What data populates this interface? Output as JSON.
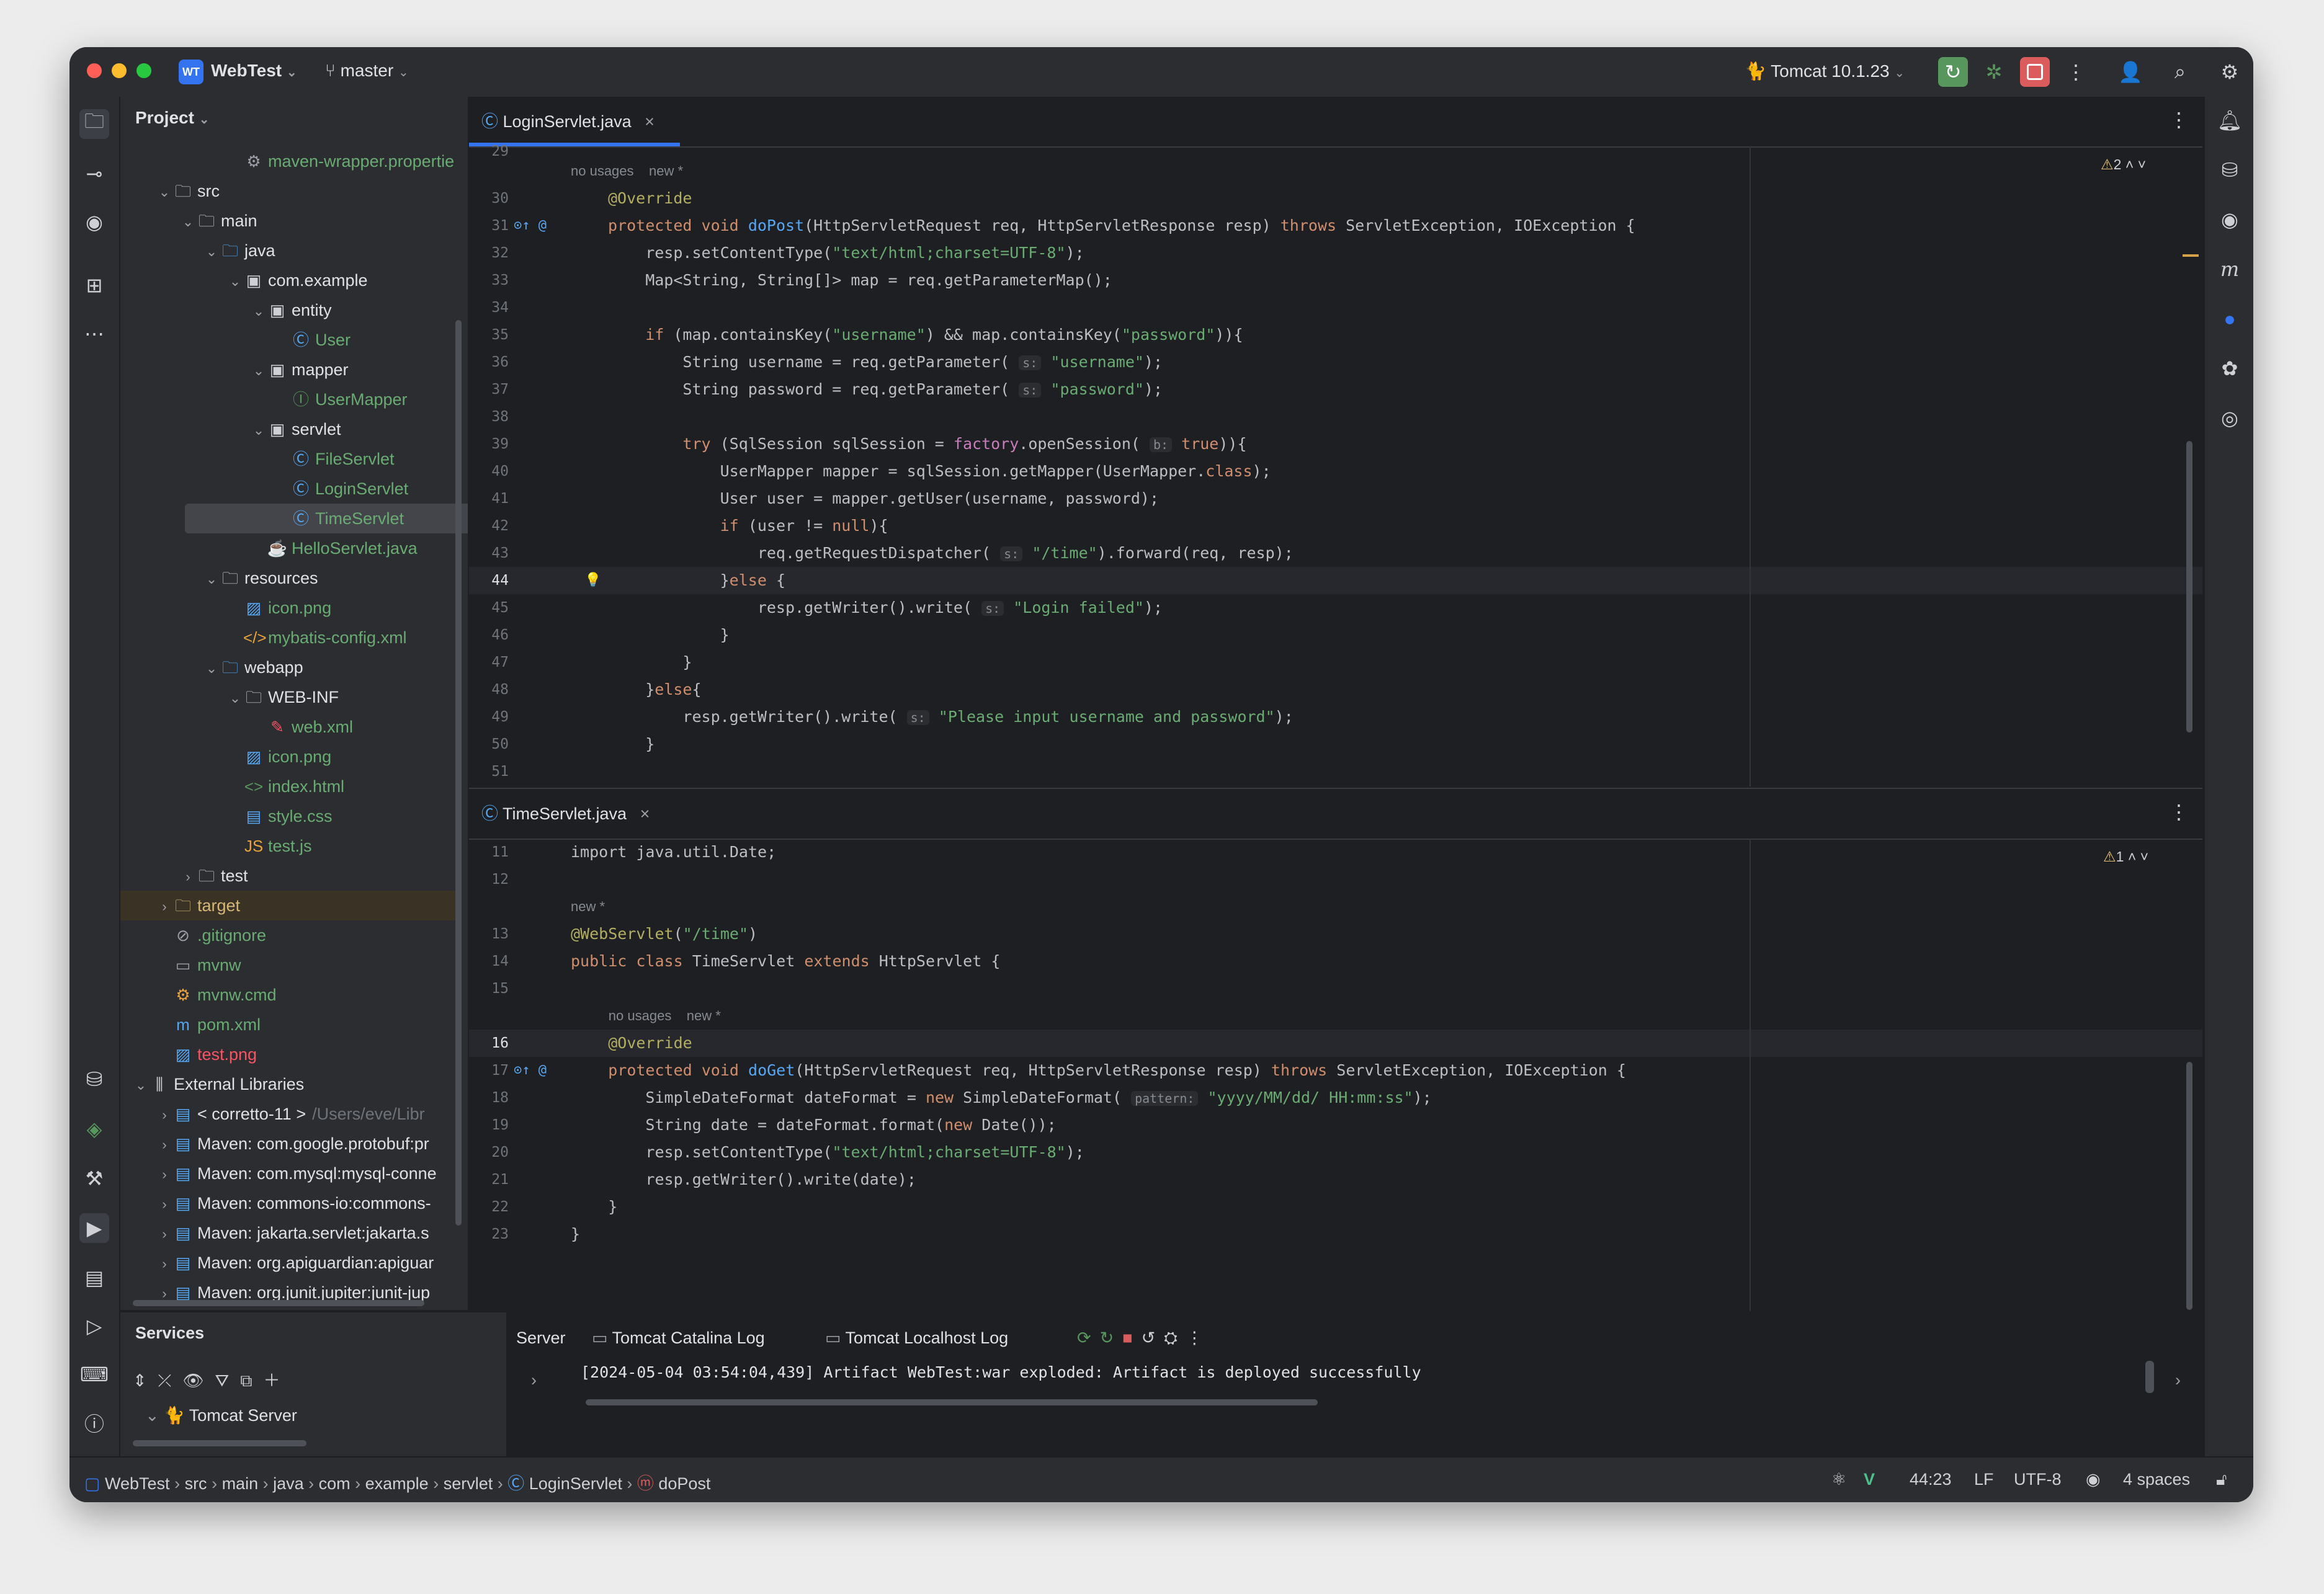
{
  "window": {
    "project_badge": "WT",
    "project_name": "WebTest",
    "branch": "master",
    "run_config": "Tomcat 10.1.23"
  },
  "project_panel": {
    "title": "Project",
    "items": [
      {
        "label": "maven-wrapper.propertie",
        "color": "#6aab73"
      },
      {
        "label": "src",
        "color": "#dfe1e5"
      },
      {
        "label": "main",
        "color": "#dfe1e5"
      },
      {
        "label": "java",
        "color": "#dfe1e5"
      },
      {
        "label": "com.example",
        "color": "#dfe1e5"
      },
      {
        "label": "entity",
        "color": "#dfe1e5"
      },
      {
        "label": "User",
        "color": "#6aab73"
      },
      {
        "label": "mapper",
        "color": "#dfe1e5"
      },
      {
        "label": "UserMapper",
        "color": "#6aab73"
      },
      {
        "label": "servlet",
        "color": "#dfe1e5"
      },
      {
        "label": "FileServlet",
        "color": "#6aab73"
      },
      {
        "label": "LoginServlet",
        "color": "#6aab73"
      },
      {
        "label": "TimeServlet",
        "color": "#6aab73"
      },
      {
        "label": "HelloServlet.java",
        "color": "#6aab73"
      },
      {
        "label": "resources",
        "color": "#dfe1e5"
      },
      {
        "label": "icon.png",
        "color": "#6aab73"
      },
      {
        "label": "mybatis-config.xml",
        "color": "#6aab73"
      },
      {
        "label": "webapp",
        "color": "#dfe1e5"
      },
      {
        "label": "WEB-INF",
        "color": "#dfe1e5"
      },
      {
        "label": "web.xml",
        "color": "#6aab73"
      },
      {
        "label": "icon.png",
        "color": "#6aab73"
      },
      {
        "label": "index.html",
        "color": "#6aab73"
      },
      {
        "label": "style.css",
        "color": "#6aab73"
      },
      {
        "label": "test.js",
        "color": "#6aab73"
      },
      {
        "label": "test",
        "color": "#dfe1e5"
      },
      {
        "label": "target",
        "color": "#d5b778"
      },
      {
        "label": ".gitignore",
        "color": "#6aab73"
      },
      {
        "label": "mvnw",
        "color": "#6aab73"
      },
      {
        "label": "mvnw.cmd",
        "color": "#6aab73"
      },
      {
        "label": "pom.xml",
        "color": "#6aab73"
      },
      {
        "label": "test.png",
        "color": "#f75464"
      },
      {
        "label": "External Libraries",
        "color": "#dfe1e5"
      },
      {
        "label": "< corretto-11 >",
        "color": "#dfe1e5",
        "suffix": "/Users/eve/Libr"
      },
      {
        "label": "Maven: com.google.protobuf:pr",
        "color": "#dfe1e5"
      },
      {
        "label": "Maven: com.mysql:mysql-conne",
        "color": "#dfe1e5"
      },
      {
        "label": "Maven: commons-io:commons-",
        "color": "#dfe1e5"
      },
      {
        "label": "Maven: jakarta.servlet:jakarta.s",
        "color": "#dfe1e5"
      },
      {
        "label": "Maven: org.apiguardian:apiguar",
        "color": "#dfe1e5"
      },
      {
        "label": "Maven: org.junit.jupiter:junit-jup",
        "color": "#dfe1e5"
      }
    ]
  },
  "editor_top": {
    "tab": "LoginServlet.java",
    "warnings": "2",
    "first_line": "29",
    "meta_usages": "no usages",
    "meta_new": "new *",
    "lines": [
      {
        "n": "30",
        "code": "@Override"
      },
      {
        "n": "31",
        "code": "protected void doPost(HttpServletRequest req, HttpServletResponse resp) throws ServletException, IOException {"
      },
      {
        "n": "32",
        "code": "    resp.setContentType(\"text/html;charset=UTF-8\");"
      },
      {
        "n": "33",
        "code": "    Map<String, String[]> map = req.getParameterMap();"
      },
      {
        "n": "34",
        "code": ""
      },
      {
        "n": "35",
        "code": "    if (map.containsKey(\"username\") && map.containsKey(\"password\")){"
      },
      {
        "n": "36",
        "code": "        String username = req.getParameter( s: \"username\");"
      },
      {
        "n": "37",
        "code": "        String password = req.getParameter( s: \"password\");"
      },
      {
        "n": "38",
        "code": ""
      },
      {
        "n": "39",
        "code": "        try (SqlSession sqlSession = factory.openSession( b: true)){"
      },
      {
        "n": "40",
        "code": "            UserMapper mapper = sqlSession.getMapper(UserMapper.class);"
      },
      {
        "n": "41",
        "code": "            User user = mapper.getUser(username, password);"
      },
      {
        "n": "42",
        "code": "            if (user != null){"
      },
      {
        "n": "43",
        "code": "                req.getRequestDispatcher( s: \"/time\").forward(req, resp);"
      },
      {
        "n": "44",
        "code": "            }else {"
      },
      {
        "n": "45",
        "code": "                resp.getWriter().write( s: \"Login failed\");"
      },
      {
        "n": "46",
        "code": "            }"
      },
      {
        "n": "47",
        "code": "        }"
      },
      {
        "n": "48",
        "code": "    }else{"
      },
      {
        "n": "49",
        "code": "        resp.getWriter().write( s: \"Please input username and password\");"
      },
      {
        "n": "50",
        "code": "    }"
      },
      {
        "n": "51",
        "code": ""
      }
    ]
  },
  "editor_bottom": {
    "tab": "TimeServlet.java",
    "warnings": "1",
    "meta_new": "new *",
    "meta_usages": "no usages",
    "lines": [
      {
        "n": "11",
        "code": "import java.util.Date;"
      },
      {
        "n": "12",
        "code": ""
      },
      {
        "n": "13",
        "code": "@WebServlet(\"/time\")"
      },
      {
        "n": "14",
        "code": "public class TimeServlet extends HttpServlet {"
      },
      {
        "n": "15",
        "code": ""
      },
      {
        "n": "16",
        "code": "    @Override"
      },
      {
        "n": "17",
        "code": "    protected void doGet(HttpServletRequest req, HttpServletResponse resp) throws ServletException, IOException {"
      },
      {
        "n": "18",
        "code": "        SimpleDateFormat dateFormat = new SimpleDateFormat( pattern: \"yyyy/MM/dd/ HH:mm:ss\");"
      },
      {
        "n": "19",
        "code": "        String date = dateFormat.format(new Date());"
      },
      {
        "n": "20",
        "code": "        resp.setContentType(\"text/html;charset=UTF-8\");"
      },
      {
        "n": "21",
        "code": "        resp.getWriter().write(date);"
      },
      {
        "n": "22",
        "code": "    }"
      },
      {
        "n": "23",
        "code": "}"
      }
    ]
  },
  "services": {
    "title": "Services",
    "tree_item": "Tomcat Server",
    "tabs": [
      "Server",
      "Tomcat Catalina Log",
      "Tomcat Localhost Log"
    ],
    "console_line": "[2024-05-04 03:54:04,439] Artifact WebTest:war exploded: Artifact is deployed successfully"
  },
  "statusbar": {
    "breadcrumbs": [
      "WebTest",
      "src",
      "main",
      "java",
      "com",
      "example",
      "servlet",
      "LoginServlet",
      "doPost"
    ],
    "position": "44:23",
    "line_sep": "LF",
    "encoding": "UTF-8",
    "indent": "4 spaces"
  },
  "colors": {
    "accent": "#3574f0",
    "run_green": "#57965c",
    "stop_red": "#db5c5c"
  }
}
